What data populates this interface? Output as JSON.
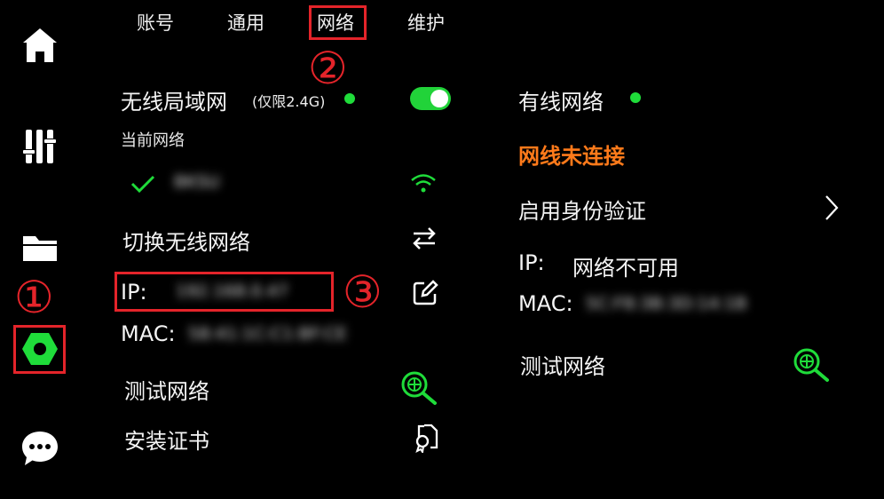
{
  "sidebar": {
    "items": [
      {
        "icon": "home-icon"
      },
      {
        "icon": "sliders-icon"
      },
      {
        "icon": "folder-icon"
      },
      {
        "icon": "settings-hex-icon",
        "active": true
      },
      {
        "icon": "chat-icon"
      }
    ],
    "annotation": "①"
  },
  "tabs": {
    "items": [
      {
        "label": "账号"
      },
      {
        "label": "通用"
      },
      {
        "label": "网络",
        "active": true
      },
      {
        "label": "维护"
      }
    ],
    "annotation": "②"
  },
  "wireless": {
    "title": "无线局域网",
    "note": "(仅限2.4G)",
    "enabled": true,
    "current_network_label": "当前网络",
    "current_ssid": "BKSU",
    "switch_label": "切换无线网络",
    "ip_label": "IP:",
    "ip_value": "192.168.0.47",
    "ip_annotation": "③",
    "mac_label": "MAC:",
    "mac_value": "58:41:1C:C1:BF:CE",
    "test_label": "测试网络",
    "cert_label": "安装证书"
  },
  "wired": {
    "title": "有线网络",
    "status": "网线未连接",
    "auth_label": "启用身份验证",
    "ip_label": "IP:",
    "ip_value": "网络不可用",
    "mac_label": "MAC:",
    "mac_value": "5C:F8:3B:3D:14:1B",
    "test_label": "测试网络"
  },
  "colors": {
    "accent_green": "#1fdc3a",
    "warning_orange": "#ff7a1a",
    "annotation_red": "#e4242a"
  }
}
